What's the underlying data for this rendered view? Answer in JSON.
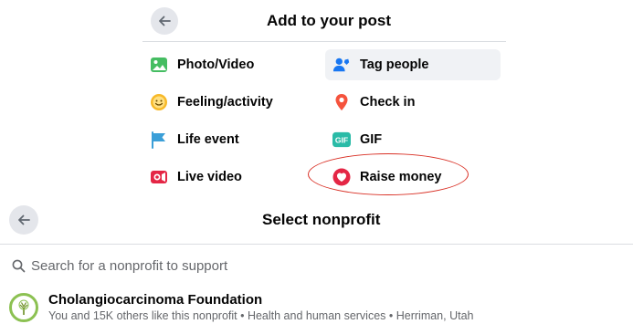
{
  "post_panel": {
    "title": "Add to your post",
    "options": [
      {
        "label": "Photo/Video",
        "icon": "photo-video-icon",
        "color": "#45bd62"
      },
      {
        "label": "Tag people",
        "icon": "tag-people-icon",
        "color": "#1877f2"
      },
      {
        "label": "Feeling/activity",
        "icon": "feeling-icon",
        "color": "#f7b928"
      },
      {
        "label": "Check in",
        "icon": "check-in-icon",
        "color": "#f5533d"
      },
      {
        "label": "Life event",
        "icon": "life-event-icon",
        "color": "#3b9fd8"
      },
      {
        "label": "GIF",
        "icon": "gif-icon",
        "color": "#2abba7"
      },
      {
        "label": "Live video",
        "icon": "live-video-icon",
        "color": "#e42645"
      },
      {
        "label": "Raise money",
        "icon": "raise-money-icon",
        "color": "#e42645"
      }
    ],
    "gif_badge": "GIF"
  },
  "nonprofit_panel": {
    "title": "Select nonprofit",
    "search": {
      "placeholder": "Search for a nonprofit to support"
    },
    "results": [
      {
        "name": "Cholangiocarcinoma Foundation",
        "details": "You and 15K others like this nonprofit • Health and human services • Herriman, Utah"
      }
    ]
  },
  "colors": {
    "highlight": "#f0f2f5",
    "annotation": "#d93025",
    "divider": "#dadde1"
  }
}
